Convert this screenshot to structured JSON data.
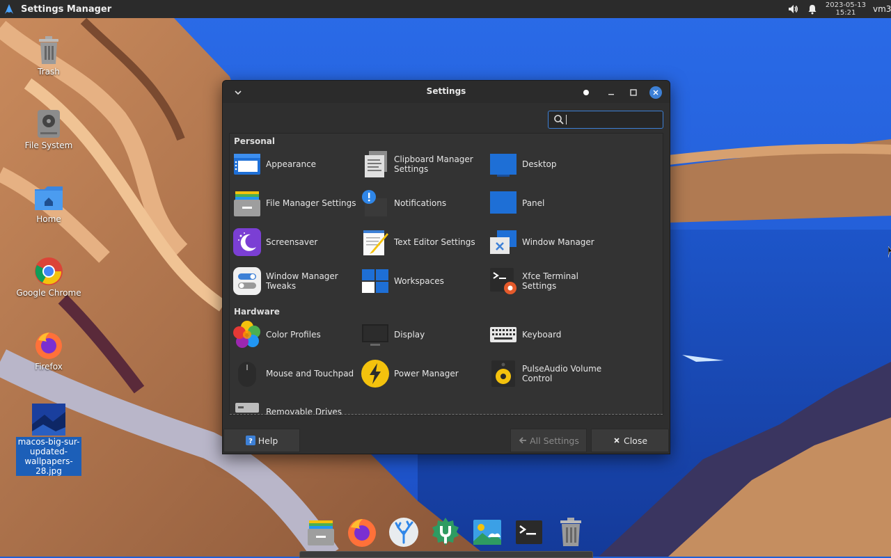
{
  "top_panel": {
    "active_window_title": "Settings Manager",
    "clock_date": "2023-05-13",
    "clock_time": "15:21",
    "user": "vm3"
  },
  "desktop_icons": [
    {
      "label": "Trash",
      "icon": "trash-icon"
    },
    {
      "label": "File System",
      "icon": "drive-icon"
    },
    {
      "label": "Home",
      "icon": "home-folder-icon"
    },
    {
      "label": "Google Chrome",
      "icon": "chrome-icon"
    },
    {
      "label": "Firefox",
      "icon": "firefox-icon"
    },
    {
      "label": "macos-big-sur-updated-wallpapers-28.jpg",
      "icon": "image-thumbnail-icon"
    }
  ],
  "settings_window": {
    "title": "Settings",
    "search_placeholder": "",
    "sections": [
      {
        "title": "Personal",
        "items": [
          {
            "label": "Appearance",
            "icon": "appearance-icon"
          },
          {
            "label": "Clipboard Manager Settings",
            "icon": "clipboard-icon"
          },
          {
            "label": "Desktop",
            "icon": "desktop-icon"
          },
          {
            "label": "File Manager Settings",
            "icon": "file-manager-icon"
          },
          {
            "label": "Notifications",
            "icon": "notifications-icon"
          },
          {
            "label": "Panel",
            "icon": "panel-icon"
          },
          {
            "label": "Screensaver",
            "icon": "screensaver-icon"
          },
          {
            "label": "Text Editor Settings",
            "icon": "text-editor-icon"
          },
          {
            "label": "Window Manager",
            "icon": "window-manager-icon"
          },
          {
            "label": "Window Manager Tweaks",
            "icon": "wm-tweaks-icon"
          },
          {
            "label": "Workspaces",
            "icon": "workspaces-icon"
          },
          {
            "label": "Xfce Terminal Settings",
            "icon": "terminal-settings-icon"
          }
        ]
      },
      {
        "title": "Hardware",
        "items": [
          {
            "label": "Color Profiles",
            "icon": "color-profiles-icon"
          },
          {
            "label": "Display",
            "icon": "display-icon"
          },
          {
            "label": "Keyboard",
            "icon": "keyboard-icon"
          },
          {
            "label": "Mouse and Touchpad",
            "icon": "mouse-icon"
          },
          {
            "label": "Power Manager",
            "icon": "power-icon"
          },
          {
            "label": "PulseAudio Volume Control",
            "icon": "speaker-icon"
          },
          {
            "label": "Removable Drives",
            "icon": "removable-drive-icon"
          }
        ]
      }
    ],
    "buttons": {
      "help": "Help",
      "all_settings": "All Settings",
      "close": "Close"
    }
  },
  "dock": [
    {
      "icon": "file-manager-icon"
    },
    {
      "icon": "firefox-icon"
    },
    {
      "icon": "app-finder-icon"
    },
    {
      "icon": "settings-tool-icon"
    },
    {
      "icon": "image-viewer-icon"
    },
    {
      "icon": "terminal-icon"
    },
    {
      "icon": "trash-icon"
    }
  ],
  "colors": {
    "accent": "#3d80d6",
    "panel_bg": "#2b2b2b",
    "window_bg": "#2f2f2f",
    "content_bg": "#333333"
  }
}
